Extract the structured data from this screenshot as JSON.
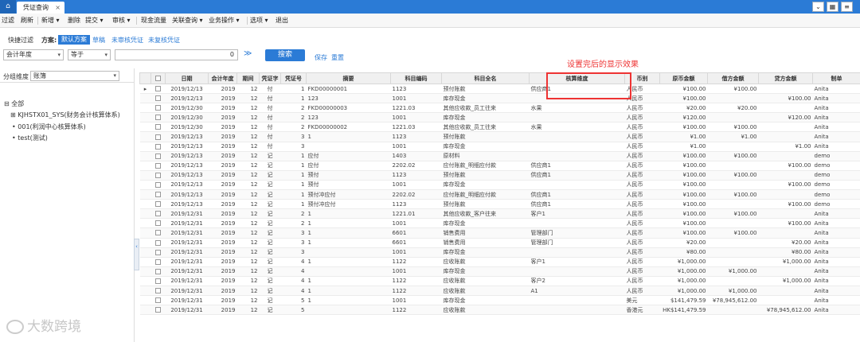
{
  "tabs": {
    "home_icon": "⌂",
    "active_label": "凭证查询",
    "close_icon": "×"
  },
  "window_buttons": [
    "⌄",
    "▦",
    "≡"
  ],
  "menu": [
    "过滤",
    "刷新",
    "新增 ▾",
    "删除",
    "提交 ▾",
    "审核 ▾",
    "现金流量",
    "关联查询 ▾",
    "业务操作 ▾",
    "选项 ▾",
    "退出"
  ],
  "filter": {
    "quick_filter": "快捷过滤",
    "scheme_label": "方案:",
    "scheme_active": "默认方案",
    "scheme_links": [
      "草稿",
      "未审核凭证",
      "未复核凭证"
    ],
    "field": "会计年度",
    "operator": "等于",
    "value": "0",
    "expand": "≫",
    "search": "搜索",
    "save": "保存",
    "reset": "重置"
  },
  "left": {
    "group_label": "分组维度",
    "group_value": "账簿",
    "tree": [
      {
        "label": "全部",
        "toggle": "⊟"
      },
      {
        "label": "KJHSTX01_SYS(财务会计核算体系)",
        "toggle": "⊞"
      },
      {
        "label": "001(利润中心核算体系)",
        "toggle": "•"
      },
      {
        "label": "test(测试)",
        "toggle": "•"
      }
    ],
    "collapse": "‹"
  },
  "annotation": "设置完后的显示效果",
  "table": {
    "columns": [
      "",
      "",
      "日期",
      "会计年度",
      "期间",
      "凭证字",
      "凭证号",
      "摘要",
      "科目编码",
      "科目全名",
      "核算维度",
      "币别",
      "原币金额",
      "借方金额",
      "贷方金额",
      "制单"
    ],
    "rows": [
      [
        "▸",
        "",
        "2019/12/13",
        "2019",
        "12",
        "付",
        "1",
        "FKD00000001",
        "1123",
        "预付账款",
        "供应商1",
        "人民币",
        "¥100.00",
        "¥100.00",
        "",
        "Anita"
      ],
      [
        "",
        "",
        "2019/12/13",
        "2019",
        "12",
        "付",
        "1",
        "123",
        "1001",
        "库存现金",
        "",
        "人民币",
        "¥100.00",
        "",
        "¥100.00",
        "Anita"
      ],
      [
        "",
        "",
        "2019/12/30",
        "2019",
        "12",
        "付",
        "2",
        "FKD00000003",
        "1221.03",
        "其他应收款_员工往来",
        "水果",
        "人民币",
        "¥20.00",
        "¥20.00",
        "",
        "Anita"
      ],
      [
        "",
        "",
        "2019/12/30",
        "2019",
        "12",
        "付",
        "2",
        "123",
        "1001",
        "库存现金",
        "",
        "人民币",
        "¥120.00",
        "",
        "¥120.00",
        "Anita"
      ],
      [
        "",
        "",
        "2019/12/30",
        "2019",
        "12",
        "付",
        "2",
        "FKD00000002",
        "1221.03",
        "其他应收款_员工往来",
        "水果",
        "人民币",
        "¥100.00",
        "¥100.00",
        "",
        "Anita"
      ],
      [
        "",
        "",
        "2019/12/13",
        "2019",
        "12",
        "付",
        "3",
        "1",
        "1123",
        "预付账款",
        "",
        "人民币",
        "¥1.00",
        "¥1.00",
        "",
        "Anita"
      ],
      [
        "",
        "",
        "2019/12/13",
        "2019",
        "12",
        "付",
        "3",
        "",
        "1001",
        "库存现金",
        "",
        "人民币",
        "¥1.00",
        "",
        "¥1.00",
        "Anita"
      ],
      [
        "",
        "",
        "2019/12/13",
        "2019",
        "12",
        "记",
        "1",
        "应付",
        "1403",
        "原材料",
        "",
        "人民币",
        "¥100.00",
        "¥100.00",
        "",
        "demo"
      ],
      [
        "",
        "",
        "2019/12/13",
        "2019",
        "12",
        "记",
        "1",
        "应付",
        "2202.02",
        "应付账款_明细应付款",
        "供应商1",
        "人民币",
        "¥100.00",
        "",
        "¥100.00",
        "demo"
      ],
      [
        "",
        "",
        "2019/12/13",
        "2019",
        "12",
        "记",
        "1",
        "预付",
        "1123",
        "预付账款",
        "供应商1",
        "人民币",
        "¥100.00",
        "¥100.00",
        "",
        "demo"
      ],
      [
        "",
        "",
        "2019/12/13",
        "2019",
        "12",
        "记",
        "1",
        "预付",
        "1001",
        "库存现金",
        "",
        "人民币",
        "¥100.00",
        "",
        "¥100.00",
        "demo"
      ],
      [
        "",
        "",
        "2019/12/13",
        "2019",
        "12",
        "记",
        "1",
        "预付冲应付",
        "2202.02",
        "应付账款_明细应付款",
        "供应商1",
        "人民币",
        "¥100.00",
        "¥100.00",
        "",
        "demo"
      ],
      [
        "",
        "",
        "2019/12/13",
        "2019",
        "12",
        "记",
        "1",
        "预付冲应付",
        "1123",
        "预付账款",
        "供应商1",
        "人民币",
        "¥100.00",
        "",
        "¥100.00",
        "demo"
      ],
      [
        "",
        "",
        "2019/12/31",
        "2019",
        "12",
        "记",
        "2",
        "1",
        "1221.01",
        "其他应收款_客户往来",
        "客户1",
        "人民币",
        "¥100.00",
        "¥100.00",
        "",
        "Anita"
      ],
      [
        "",
        "",
        "2019/12/31",
        "2019",
        "12",
        "记",
        "2",
        "1",
        "1001",
        "库存现金",
        "",
        "人民币",
        "¥100.00",
        "",
        "¥100.00",
        "Anita"
      ],
      [
        "",
        "",
        "2019/12/31",
        "2019",
        "12",
        "记",
        "3",
        "1",
        "6601",
        "销售费用",
        "管理部门",
        "人民币",
        "¥100.00",
        "¥100.00",
        "",
        "Anita"
      ],
      [
        "",
        "",
        "2019/12/31",
        "2019",
        "12",
        "记",
        "3",
        "1",
        "6601",
        "销售费用",
        "管理部门",
        "人民币",
        "¥20.00",
        "",
        "¥20.00",
        "Anita"
      ],
      [
        "",
        "",
        "2019/12/31",
        "2019",
        "12",
        "记",
        "3",
        "",
        "1001",
        "库存现金",
        "",
        "人民币",
        "¥80.00",
        "",
        "¥80.00",
        "Anita"
      ],
      [
        "",
        "",
        "2019/12/31",
        "2019",
        "12",
        "记",
        "4",
        "1",
        "1122",
        "应收账款",
        "客户1",
        "人民币",
        "¥1,000.00",
        "",
        "¥1,000.00",
        "Anita"
      ],
      [
        "",
        "",
        "2019/12/31",
        "2019",
        "12",
        "记",
        "4",
        "",
        "1001",
        "库存现金",
        "",
        "人民币",
        "¥1,000.00",
        "¥1,000.00",
        "",
        "Anita"
      ],
      [
        "",
        "",
        "2019/12/31",
        "2019",
        "12",
        "记",
        "4",
        "1",
        "1122",
        "应收账款",
        "客户2",
        "人民币",
        "¥1,000.00",
        "",
        "¥1,000.00",
        "Anita"
      ],
      [
        "",
        "",
        "2019/12/31",
        "2019",
        "12",
        "记",
        "4",
        "1",
        "1122",
        "应收账款",
        "A1",
        "人民币",
        "¥1,000.00",
        "¥1,000.00",
        "",
        "Anita"
      ],
      [
        "",
        "",
        "2019/12/31",
        "2019",
        "12",
        "记",
        "5",
        "1",
        "1001",
        "库存现金",
        "",
        "美元",
        "$141,479.59",
        "¥78,945,612.00",
        "",
        "Anita"
      ],
      [
        "",
        "",
        "2019/12/31",
        "2019",
        "12",
        "记",
        "5",
        "",
        "1122",
        "应收账款",
        "",
        "香港元",
        "HK$141,479.59",
        "",
        "¥78,945,612.00",
        "Anita"
      ]
    ]
  },
  "watermark": "大数跨境"
}
